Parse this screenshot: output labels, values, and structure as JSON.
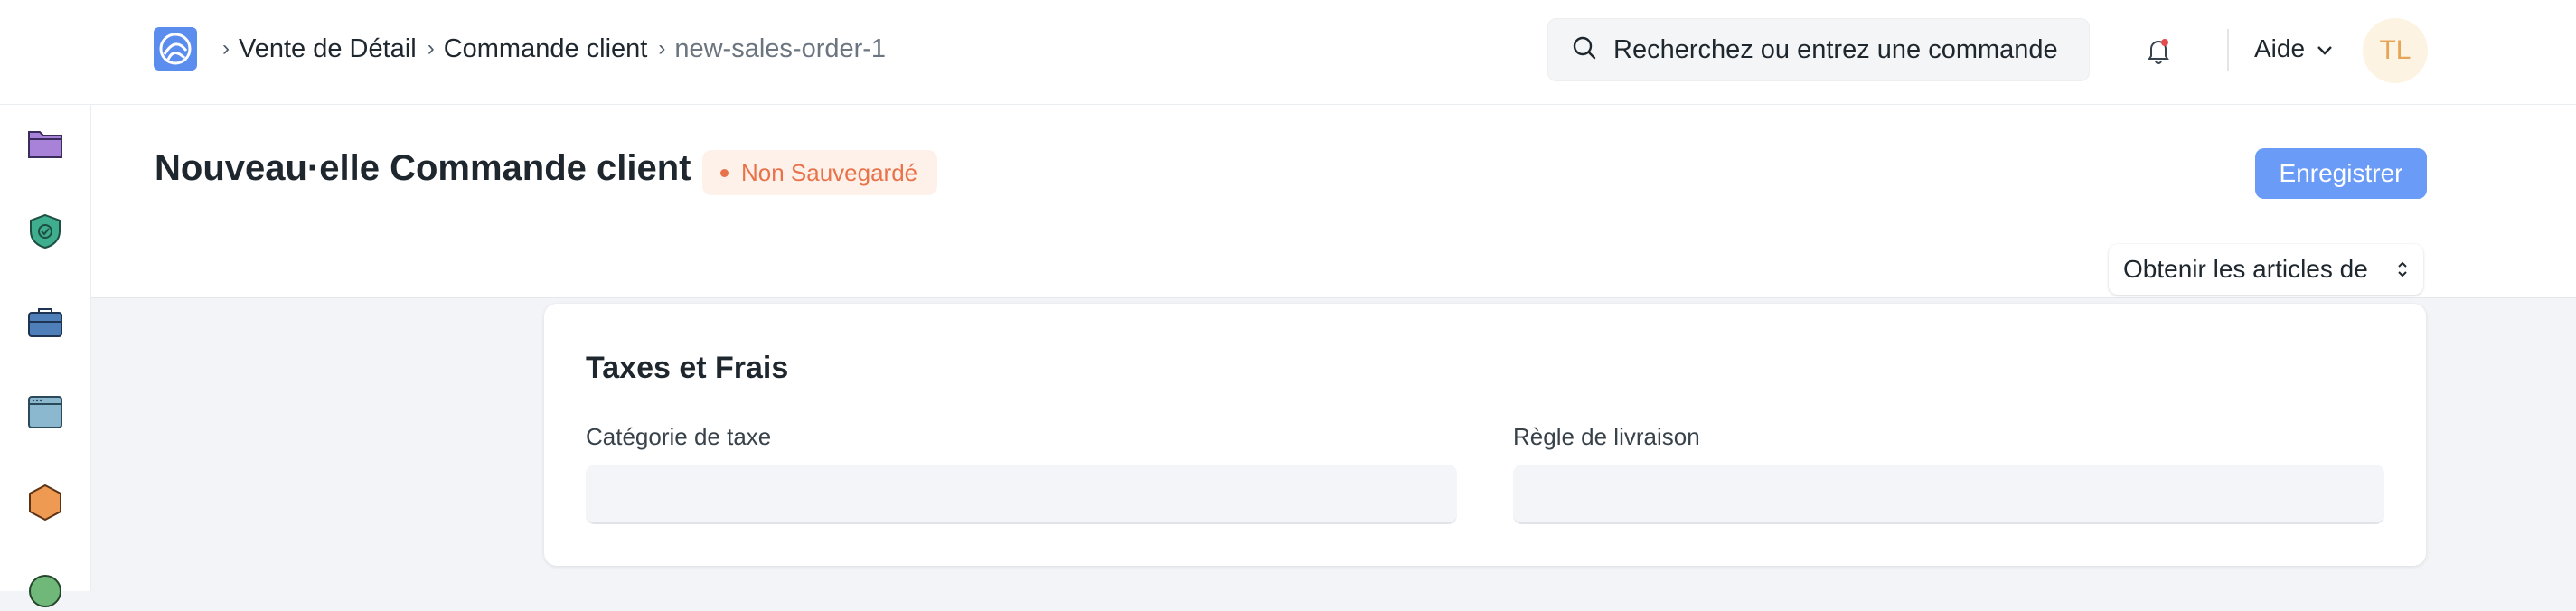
{
  "breadcrumb": {
    "items": [
      "Vente de Détail",
      "Commande client",
      "new-sales-order-1"
    ]
  },
  "search": {
    "placeholder": "Recherchez ou entrez une commande"
  },
  "help": {
    "label": "Aide"
  },
  "user": {
    "initials": "TL"
  },
  "page": {
    "title": "Nouveau·elle Commande client",
    "status": "Non Sauvegardé",
    "save_label": "Enregistrer",
    "get_items_label": "Obtenir les articles de"
  },
  "section": {
    "title": "Taxes et Frais",
    "fields": [
      {
        "label": "Catégorie de taxe",
        "value": ""
      },
      {
        "label": "Règle de livraison",
        "value": ""
      }
    ]
  },
  "sidebar": {
    "icons": [
      "folder-icon",
      "shield-check-icon",
      "briefcase-icon",
      "window-icon",
      "hexagon-icon",
      "circle-icon"
    ]
  },
  "colors": {
    "primary": "#6a9bf7",
    "status_warning": "#e8734a",
    "avatar_bg": "#fdf3e3"
  }
}
